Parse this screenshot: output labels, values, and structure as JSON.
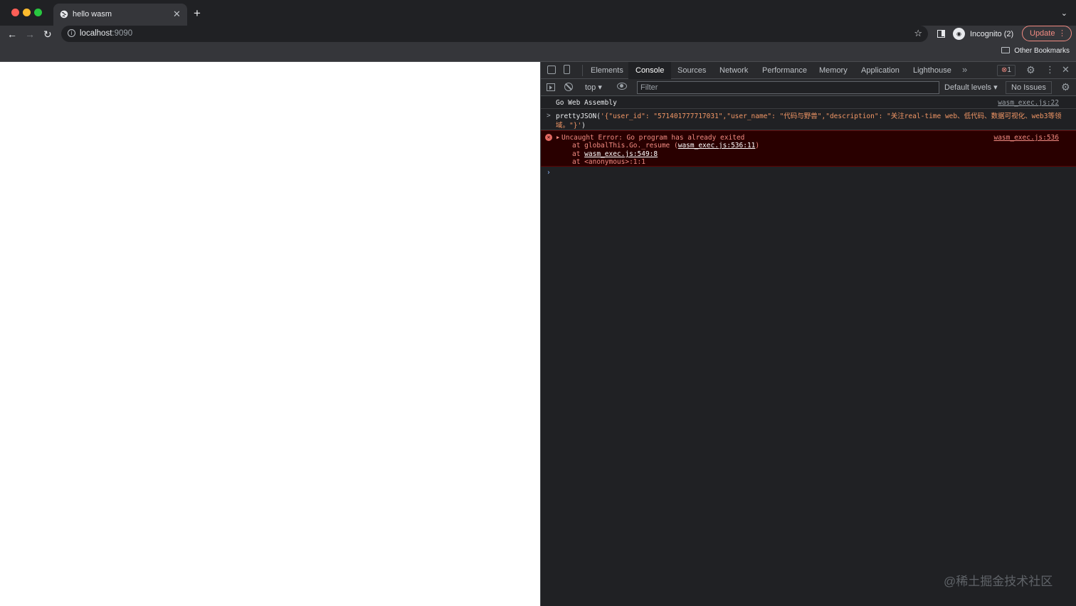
{
  "tab": {
    "title": "hello wasm",
    "close": "✕",
    "new_tab": "+",
    "menu": "⌄"
  },
  "toolbar": {
    "back": "←",
    "forward": "→",
    "reload": "↻",
    "url_host": "localhost",
    "url_port": ":9090",
    "star": "☆",
    "profile_label": "Incognito (2)",
    "update_label": "Update"
  },
  "bookmarks": {
    "other": "Other Bookmarks"
  },
  "devtools": {
    "tabs": [
      "Elements",
      "Console",
      "Sources",
      "Network",
      "Performance",
      "Memory",
      "Application",
      "Lighthouse"
    ],
    "active_tab": "Console",
    "more": "»",
    "error_count": "1",
    "filterbar": {
      "context": "top",
      "filter_placeholder": "Filter",
      "levels": "Default levels",
      "issues": "No Issues"
    }
  },
  "console": {
    "log_text": "Go Web Assembly",
    "log_source": "wasm_exec.js:22",
    "input_fn": "prettyJSON(",
    "input_str": "'{\"user_id\": \"571401777717031\",\"user_name\": \"代码与野兽\",\"description\": \"关注real-time web、低代码、数据可视化、web3等领域。\"}'",
    "input_close": ")",
    "error": {
      "message": "Uncaught Error: Go program has already exited",
      "source": "wasm_exec.js:536",
      "trace1_prefix": "at globalThis.Go._resume (",
      "trace1_link": "wasm_exec.js:536:11",
      "trace1_suffix": ")",
      "trace2_prefix": "at ",
      "trace2_link": "wasm_exec.js:549:8",
      "trace3": "at <anonymous>:1:1"
    }
  },
  "watermark": "@稀土掘金技术社区"
}
